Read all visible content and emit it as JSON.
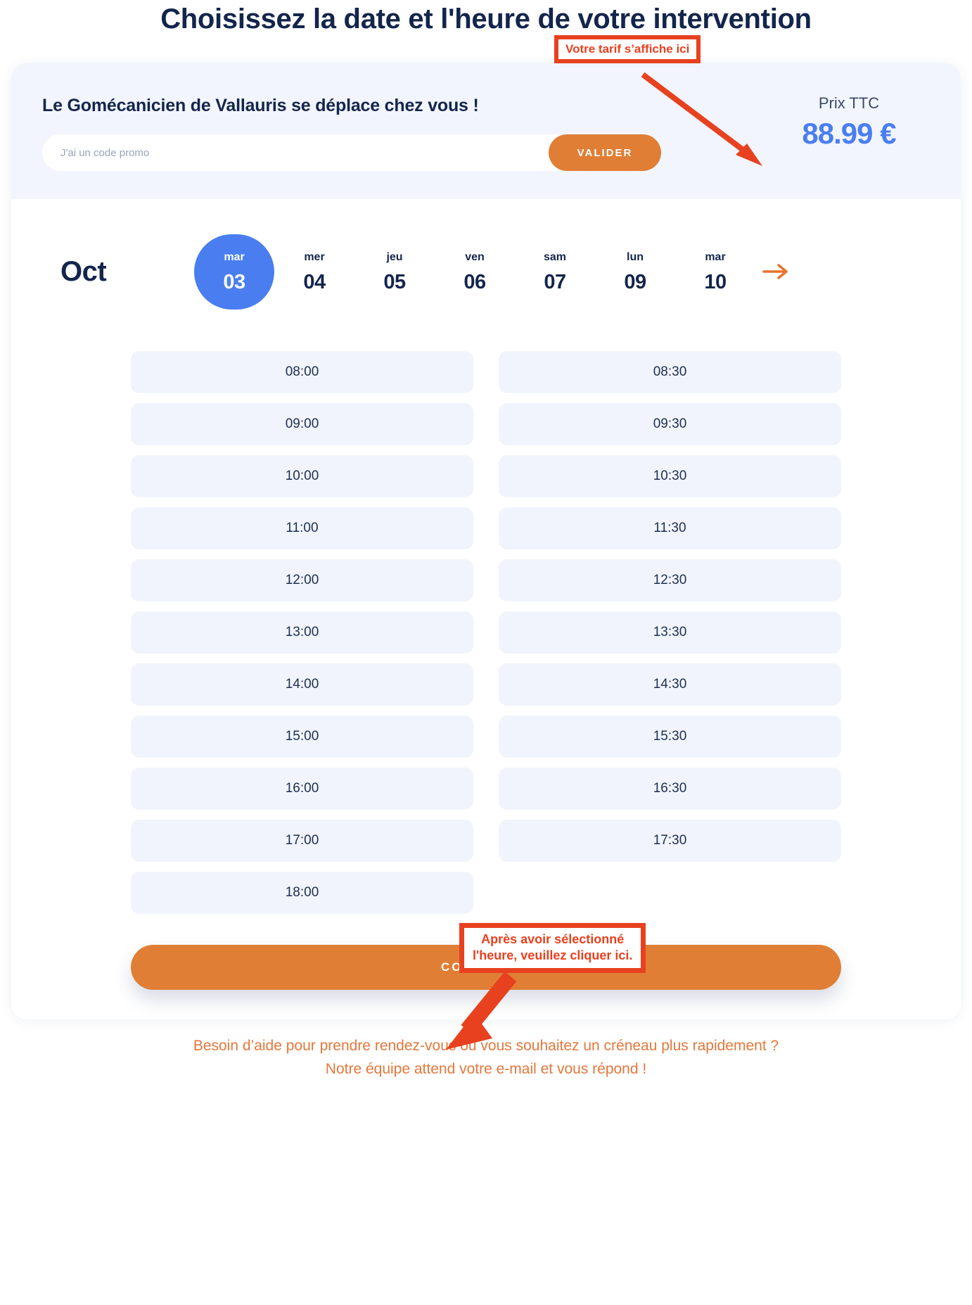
{
  "page": {
    "title": "Choisissez la date et l'heure de votre intervention"
  },
  "promo": {
    "heading": "Le Gomécanicien de Vallauris se déplace chez vous !",
    "placeholder": "J'ai un code promo",
    "value": "",
    "validate_label": "VALIDER"
  },
  "price": {
    "label": "Prix TTC",
    "value": "88.99 €",
    "color": "#4a7ef0"
  },
  "annotations": {
    "tarif": "Votre tarif s’affiche ici",
    "click_line1": "Après avoir sélectionné",
    "click_line2": "l'heure, veuillez cliquer ici.",
    "color": "#e8411f"
  },
  "calendar": {
    "month": "Oct",
    "next_icon": "arrow-right-icon",
    "days": [
      {
        "dow": "mar",
        "num": "03",
        "selected": true
      },
      {
        "dow": "mer",
        "num": "04",
        "selected": false
      },
      {
        "dow": "jeu",
        "num": "05",
        "selected": false
      },
      {
        "dow": "ven",
        "num": "06",
        "selected": false
      },
      {
        "dow": "sam",
        "num": "07",
        "selected": false
      },
      {
        "dow": "lun",
        "num": "09",
        "selected": false
      },
      {
        "dow": "mar",
        "num": "10",
        "selected": false
      }
    ]
  },
  "slots": [
    "08:00",
    "08:30",
    "09:00",
    "09:30",
    "10:00",
    "10:30",
    "11:00",
    "11:30",
    "12:00",
    "12:30",
    "13:00",
    "13:30",
    "14:00",
    "14:30",
    "15:00",
    "15:30",
    "16:00",
    "16:30",
    "17:00",
    "17:30",
    "18:00",
    ""
  ],
  "actions": {
    "continue_label": "CONTINUER"
  },
  "footer": {
    "line1": "Besoin d’aide pour prendre rendez-vous ou vous souhaitez un créneau plus rapidement ?",
    "line2": "Notre équipe attend votre e-mail et vous répond !"
  }
}
